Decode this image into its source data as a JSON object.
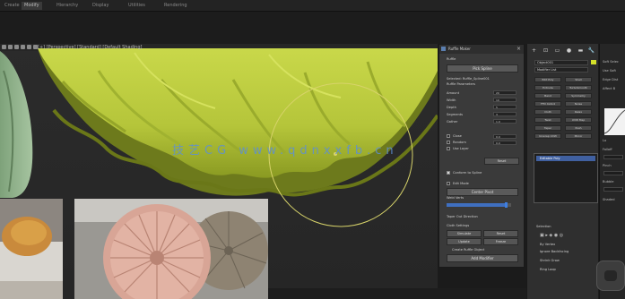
{
  "menu": {
    "items": [
      "Create",
      "Modify",
      "Hierarchy",
      "Display",
      "Utilities",
      "Rendering"
    ]
  },
  "viewport": {
    "label": "[+] [Perspective] [Standard] [Default Shading]"
  },
  "watermark": {
    "text": "技艺CG www.qdnxxfb.cn"
  },
  "dialog": {
    "title": "Ruffle Maker",
    "section_1": "Ruffle",
    "pick_button": "Pick Spline",
    "line_1": "Selected: Ruffle_Spline001",
    "line_2": "Ruffle Parameters",
    "params": [
      {
        "label": "Amount",
        "value": "20"
      },
      {
        "label": "Width",
        "value": "10"
      },
      {
        "label": "Depth",
        "value": "5"
      },
      {
        "label": "Segments",
        "value": "3"
      },
      {
        "label": "Gather",
        "value": "1.0"
      }
    ],
    "checks_a": [
      {
        "label": "Close",
        "value": "0.0"
      },
      {
        "label": "Random",
        "value": "0.0"
      },
      {
        "label": "Use Layer",
        "value": ""
      }
    ],
    "reset_label": "Reset",
    "opt_1": "Conform to Spline",
    "opt_2": "Edit Mode",
    "center_btn": "Center Pivot",
    "weld_label": "Weld Verts",
    "slider_value": 0.92,
    "section_2": "Taper Out Direction",
    "section_3": "Cloth Settings",
    "grid_buttons": [
      "Simulate",
      "Reset",
      "Update",
      "Freeze"
    ],
    "create_btn": "Create Ruffle Object",
    "export_btn": "Add Modifier"
  },
  "command_panel": {
    "tabs": [
      "+",
      "⊡",
      "▭",
      "●",
      "▬",
      "🔧"
    ],
    "object_name": "Object001",
    "modifier_list": "Modifier List",
    "buttons": [
      "Edit Poly",
      "Shell",
      "Extrude",
      "TurboSmooth",
      "Bend",
      "Symmetry",
      "FFD 4x4x4",
      "Noise",
      "Cloth",
      "Relax",
      "Twist",
      "UVW Map",
      "Taper",
      "Push",
      "Unwrap UVW",
      "Mirror"
    ],
    "stack_item": "Editable Poly",
    "selection": "Selection",
    "bottom_rows": [
      "▣ ▸ ◈ ◉ ◎",
      "By Vertex",
      "Ignore Backfacing",
      "Shrink  Grow",
      "Ring  Loop"
    ]
  },
  "far_right": {
    "lines": [
      "Soft Selec",
      "Use Soft",
      "Edge Dist",
      "Affect B",
      "Falloff",
      "Pinch",
      "Bubble",
      "Shaded"
    ],
    "values": [
      "Lo",
      "2.0",
      "0.0"
    ]
  }
}
